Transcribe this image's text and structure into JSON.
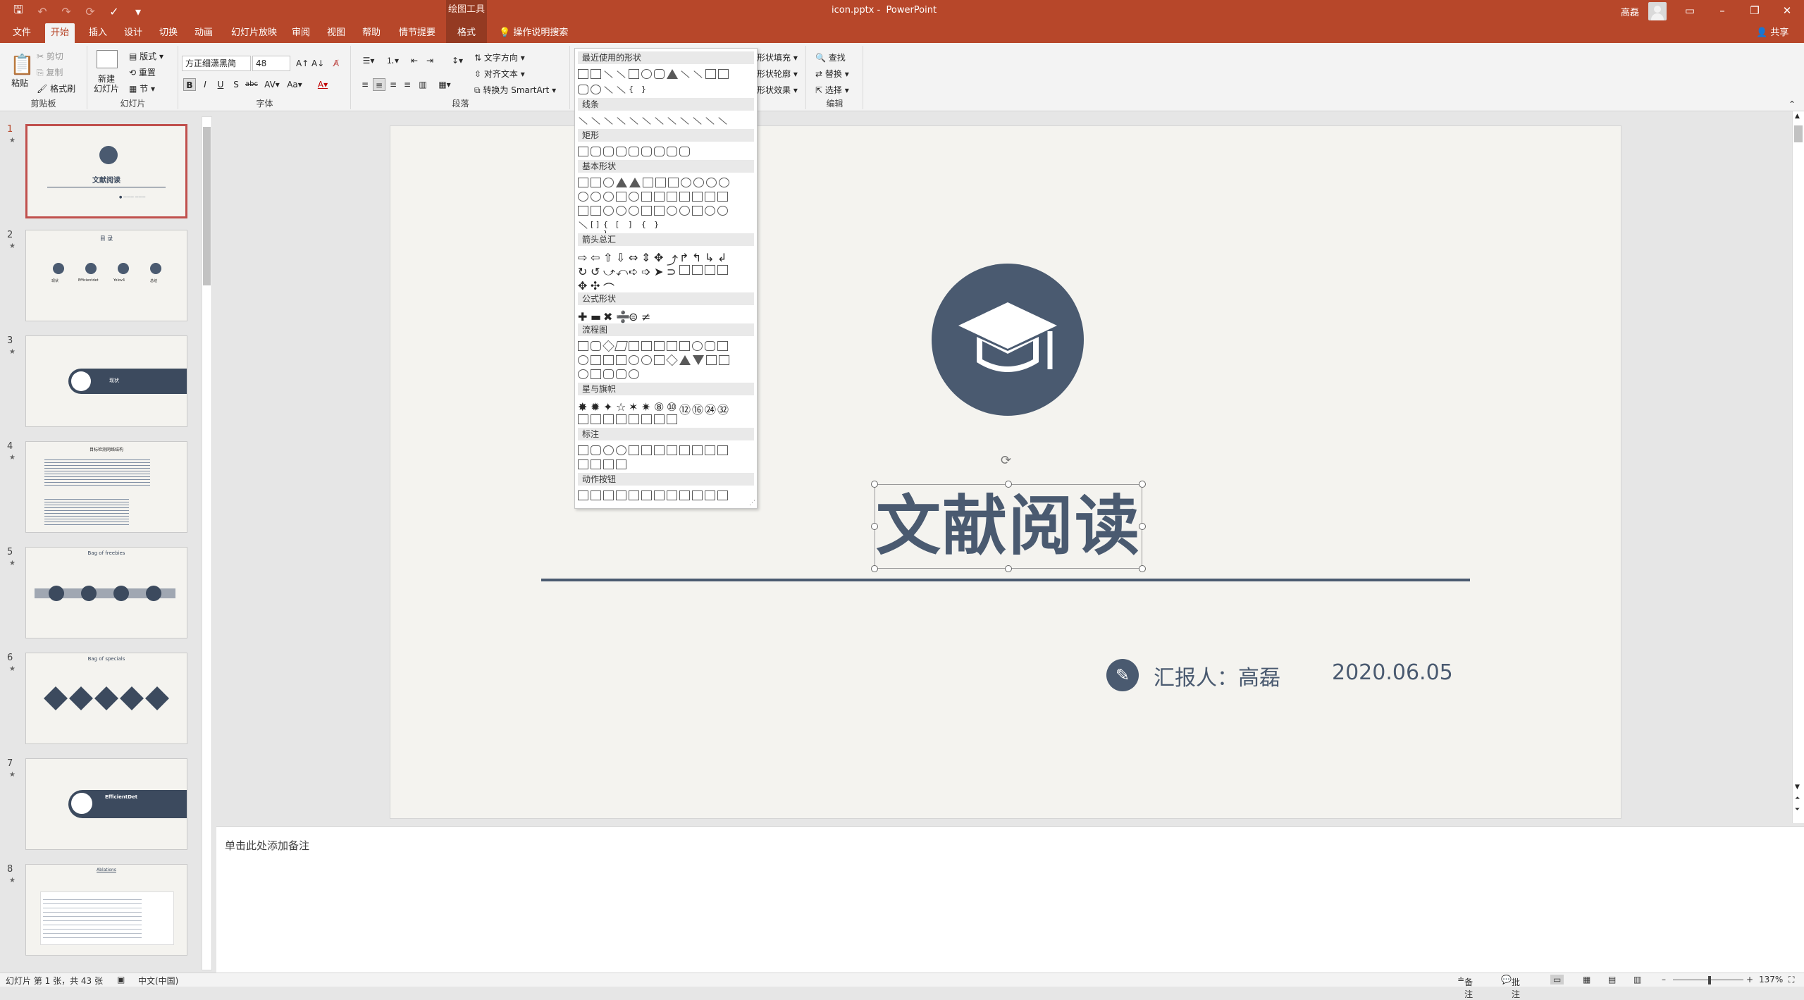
{
  "window": {
    "file": "icon.pptx",
    "app": "PowerPoint",
    "user": "高磊",
    "context_tool": "绘图工具"
  },
  "tabs": [
    {
      "label": "文件"
    },
    {
      "label": "开始"
    },
    {
      "label": "插入"
    },
    {
      "label": "设计"
    },
    {
      "label": "切换"
    },
    {
      "label": "动画"
    },
    {
      "label": "幻灯片放映"
    },
    {
      "label": "审阅"
    },
    {
      "label": "视图"
    },
    {
      "label": "帮助"
    },
    {
      "label": "情节提要"
    },
    {
      "label": "格式"
    }
  ],
  "tell_me": "操作说明搜索",
  "share": "共享",
  "ribbon": {
    "clipboard": {
      "paste": "粘贴",
      "cut": "剪切",
      "copy": "复制",
      "format_painter": "格式刷",
      "group": "剪贴板"
    },
    "slides": {
      "new_slide": "新建\n幻灯片",
      "layout": "版式",
      "reset": "重置",
      "section": "节",
      "group": "幻灯片"
    },
    "font": {
      "family": "方正细潇黑简",
      "size": "48",
      "group": "字体"
    },
    "paragraph": {
      "text_direction": "文字方向",
      "align_text": "对齐文本",
      "smartart": "转换为 SmartArt",
      "group": "段落"
    },
    "drawing": {
      "fill": "形状填充",
      "outline": "形状轮廓",
      "effects": "形状效果"
    },
    "editing": {
      "find": "查找",
      "replace": "替换",
      "select": "选择",
      "group": "编辑"
    }
  },
  "shape_gallery": {
    "sections": [
      "最近使用的形状",
      "线条",
      "矩形",
      "基本形状",
      "箭头总汇",
      "公式形状",
      "流程图",
      "星与旗帜",
      "标注",
      "动作按钮"
    ]
  },
  "slide": {
    "title": "文献阅读",
    "reporter": "汇报人：高磊",
    "date": "2020.06.05"
  },
  "thumbs": [
    {
      "num": "1",
      "title": "文献阅读"
    },
    {
      "num": "2",
      "title": "目 录",
      "items": [
        "现状",
        "Efficientdet",
        "Yolov4",
        "总结"
      ]
    },
    {
      "num": "3",
      "title": "现状"
    },
    {
      "num": "4",
      "title": "目标检测网络结构"
    },
    {
      "num": "5",
      "title": "Bag of freebies"
    },
    {
      "num": "6",
      "title": "Bag of specials"
    },
    {
      "num": "7",
      "title": "EfficientDet"
    },
    {
      "num": "8",
      "title": "Ablations"
    }
  ],
  "notes_placeholder": "单击此处添加备注",
  "status": {
    "slide_info": "幻灯片 第 1 张，共 43 张",
    "language": "中文(中国)",
    "notes": "备注",
    "comments": "批注",
    "zoom": "137%"
  }
}
